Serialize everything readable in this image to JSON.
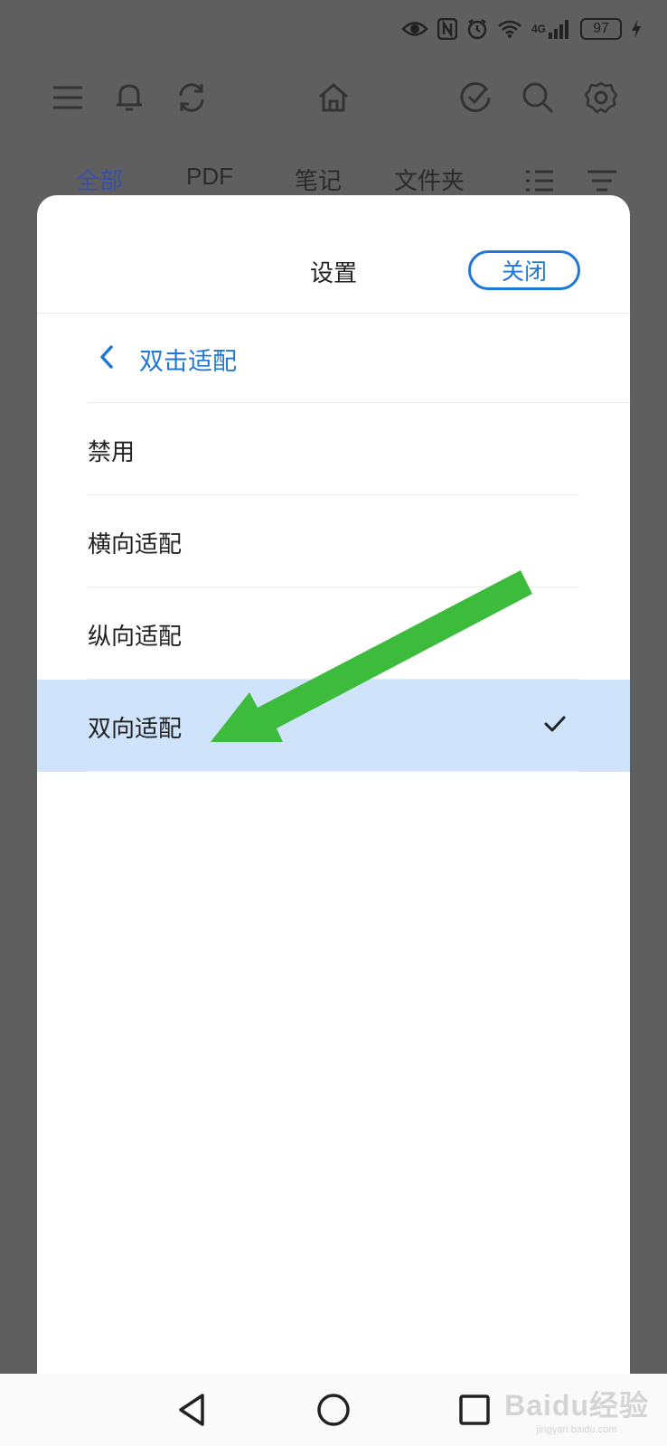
{
  "status_bar": {
    "battery_level": "97",
    "network_label": "4G",
    "icons": [
      "eye-icon",
      "nfc-icon",
      "alarm-icon",
      "wifi-icon",
      "signal-icon",
      "battery-icon",
      "charging-icon"
    ]
  },
  "toolbar": {
    "icons": [
      "menu-icon",
      "bell-icon",
      "sync-icon",
      "home-icon",
      "check-circle-icon",
      "search-icon",
      "gear-icon"
    ]
  },
  "tabs": [
    {
      "label": "全部",
      "active": true
    },
    {
      "label": "PDF",
      "active": false
    },
    {
      "label": "笔记",
      "active": false
    },
    {
      "label": "文件夹",
      "active": false
    }
  ],
  "settings_sheet": {
    "title": "设置",
    "close_label": "关闭",
    "back_label": "双击适配",
    "options": [
      {
        "label": "禁用",
        "selected": false
      },
      {
        "label": "横向适配",
        "selected": false
      },
      {
        "label": "纵向适配",
        "selected": false
      },
      {
        "label": "双向适配",
        "selected": true
      }
    ]
  },
  "colors": {
    "accent": "#1f78d6",
    "selected_row": "#cfe3fb",
    "overlay": "#5f5f5f",
    "annotation_arrow": "#3dbb3d"
  },
  "watermark": {
    "main": "Baidu经验",
    "sub": "jingyan.baidu.com"
  }
}
